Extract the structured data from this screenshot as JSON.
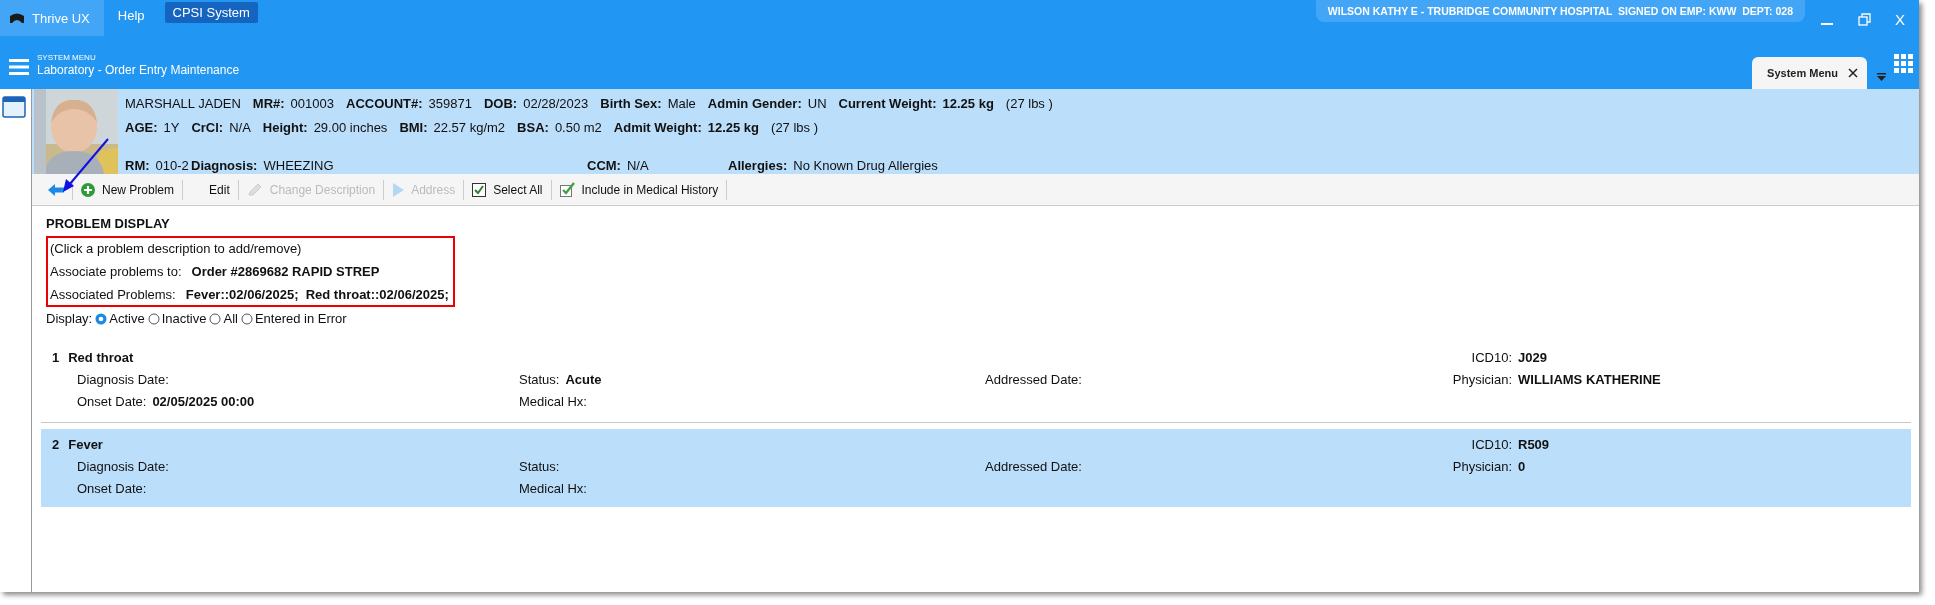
{
  "menu_bar": [
    {
      "label": "Thrive UX",
      "kind": "tab"
    },
    {
      "label": "Help",
      "kind": "link"
    },
    {
      "label": "CPSI System",
      "kind": "badge"
    }
  ],
  "user_banner": "WILSON KATHY E - TRUBRIDGE COMMUNITY HOSPITAL  SIGNED ON EMP: KWW  DEPT: 028",
  "window_controls": {
    "close": "X"
  },
  "header": {
    "subtitle": "SYSTEM MENU",
    "title": "Laboratory - Order Entry Maintenance"
  },
  "open_tabs": [
    {
      "label": "System Menu",
      "selected": true
    }
  ],
  "patient": {
    "name": "MARSHALL JADEN",
    "identity": [
      {
        "label": "MR#:",
        "value": "001003",
        "bold": false
      },
      {
        "label": "ACCOUNT#:",
        "value": "359871",
        "bold": false
      },
      {
        "label": "DOB:",
        "value": "02/28/2023",
        "bold": false
      },
      {
        "label": "Birth Sex:",
        "value": "Male",
        "bold": false
      },
      {
        "label": "Admin Gender:",
        "value": "UN",
        "bold": false
      },
      {
        "label": "Current Weight:",
        "value": "12.25 kg",
        "bold": true,
        "note": "(27 lbs )"
      }
    ],
    "measures": [
      {
        "label": "AGE:",
        "value": "1Y",
        "bold": false
      },
      {
        "label": "CrCl:",
        "value": "N/A",
        "bold": false
      },
      {
        "label": "Height:",
        "value": "29.00 inches",
        "bold": false
      },
      {
        "label": "BMI:",
        "value": "22.57 kg/m2",
        "bold": false
      },
      {
        "label": "BSA:",
        "value": "0.50 m2",
        "bold": false
      },
      {
        "label": "Admit Weight:",
        "value": "12.25 kg",
        "bold": true,
        "note": "(27 lbs )"
      }
    ],
    "clinical": [
      {
        "label": "RM:",
        "value": "010-2",
        "bold": false
      },
      {
        "label": "Diagnosis:",
        "value": "WHEEZING",
        "bold": false
      },
      {
        "label": "CCM:",
        "value": "N/A",
        "bold": false
      },
      {
        "label": "Allergies:",
        "value": "No Known Drug Allergies",
        "bold": false
      }
    ]
  },
  "toolbar": [
    {
      "label": "New Problem",
      "disabled": false
    },
    {
      "label": "Edit",
      "disabled": false
    },
    {
      "label": "Change Description",
      "disabled": true
    },
    {
      "label": "Address",
      "disabled": true
    },
    {
      "label": "Select All",
      "disabled": false
    },
    {
      "label": "Include in Medical History",
      "disabled": false
    }
  ],
  "problem_display": {
    "title": "PROBLEM DISPLAY",
    "hint": "(Click a problem description to add/remove)",
    "associations": [
      {
        "label": "Associate problems to:",
        "value": "Order #2869682 RAPID STREP"
      },
      {
        "label": "Associated Problems:",
        "value": "Fever::02/06/2025;  Red throat::02/06/2025;"
      }
    ],
    "filter": {
      "label": "Display:",
      "options": [
        {
          "label": "Active",
          "selected": true
        },
        {
          "label": "Inactive",
          "selected": false
        },
        {
          "label": "All",
          "selected": false
        },
        {
          "label": "Entered in Error",
          "selected": false
        }
      ]
    }
  },
  "problems": [
    {
      "number": "1",
      "name": "Red throat",
      "selected": false,
      "icd10": {
        "label": "ICD10:",
        "value": "J029"
      },
      "fields": [
        {
          "label": "Diagnosis Date:"
        },
        {
          "label": "Status:",
          "value": "Acute"
        },
        {
          "label": "Addressed Date:"
        },
        {
          "label": "Physician:",
          "value": "WILLIAMS KATHERINE"
        },
        {
          "label": "Onset Date:",
          "value": "02/05/2025 00:00"
        },
        {
          "label": "Medical Hx:"
        }
      ]
    },
    {
      "number": "2",
      "name": "Fever",
      "selected": true,
      "icd10": {
        "label": "ICD10:",
        "value": "R509"
      },
      "fields": [
        {
          "label": "Diagnosis Date:"
        },
        {
          "label": "Status:"
        },
        {
          "label": "Addressed Date:"
        },
        {
          "label": "Physician:",
          "value": "0"
        },
        {
          "label": "Onset Date:"
        },
        {
          "label": "Medical Hx:"
        }
      ]
    }
  ]
}
